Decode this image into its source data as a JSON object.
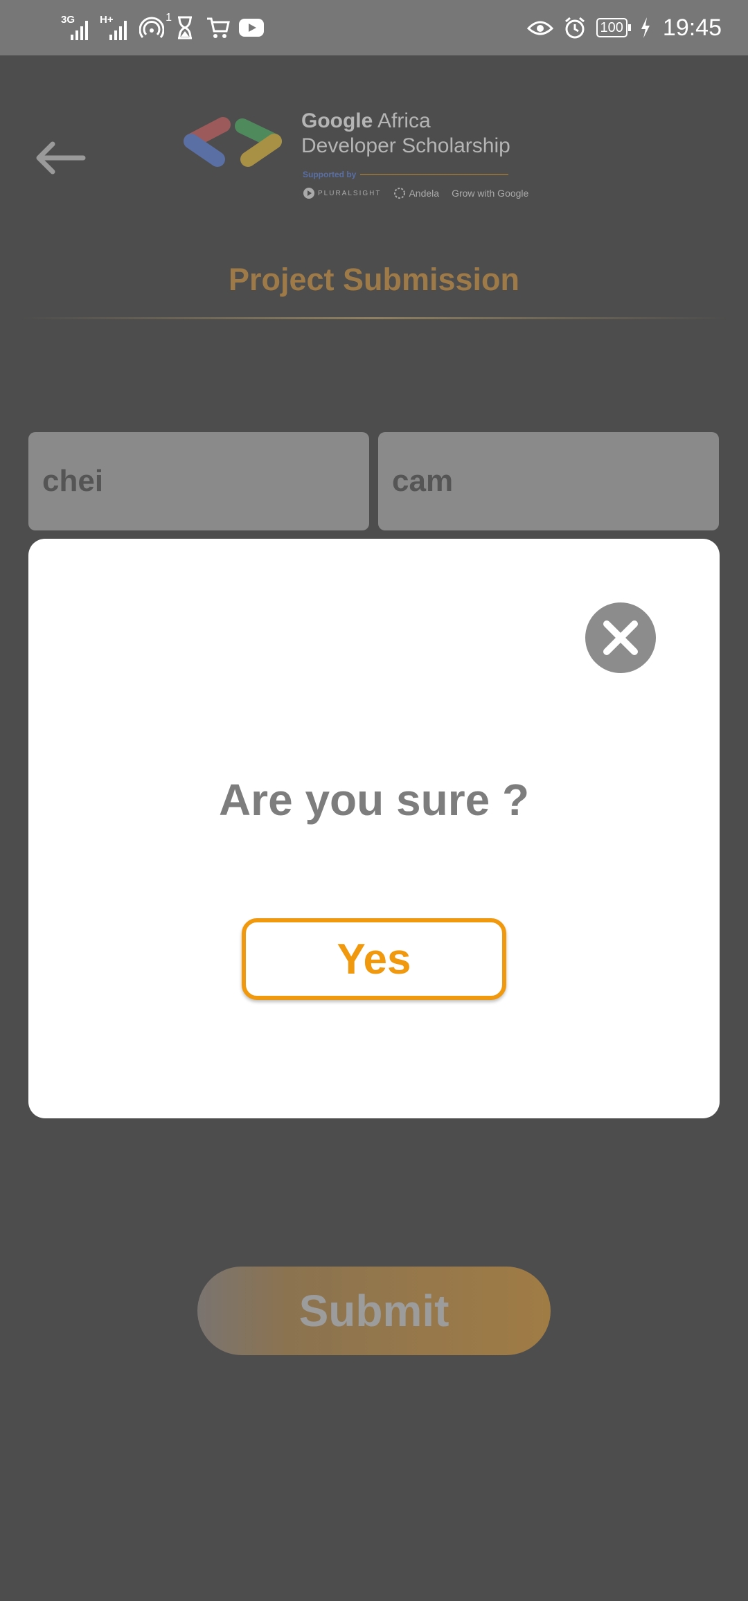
{
  "status_bar": {
    "signal1_label": "3G",
    "signal2_label": "H+",
    "hotspot_count": "1",
    "battery": "100",
    "time": "19:45",
    "icons": [
      "signal-icon",
      "signal-icon",
      "hotspot-icon",
      "hourglass-icon",
      "cart-icon",
      "youtube-icon",
      "eye-icon",
      "alarm-icon",
      "battery-icon",
      "charging-icon"
    ]
  },
  "header": {
    "logo_line1_bold": "Google",
    "logo_line1_rest": " Africa",
    "logo_line2": "Developer Scholarship",
    "logo_supported": "Supported by",
    "partners": [
      "PLURALSIGHT",
      "Andela",
      "Grow with Google"
    ]
  },
  "page": {
    "title": "Project Submission",
    "first_name": "chei",
    "last_name": "cam",
    "submit_label": "Submit"
  },
  "dialog": {
    "title": "Are you sure ?",
    "yes_label": "Yes"
  },
  "colors": {
    "accent": "#f0980e",
    "title_color": "#9e7a48",
    "overlay": "#4d4d4d"
  }
}
